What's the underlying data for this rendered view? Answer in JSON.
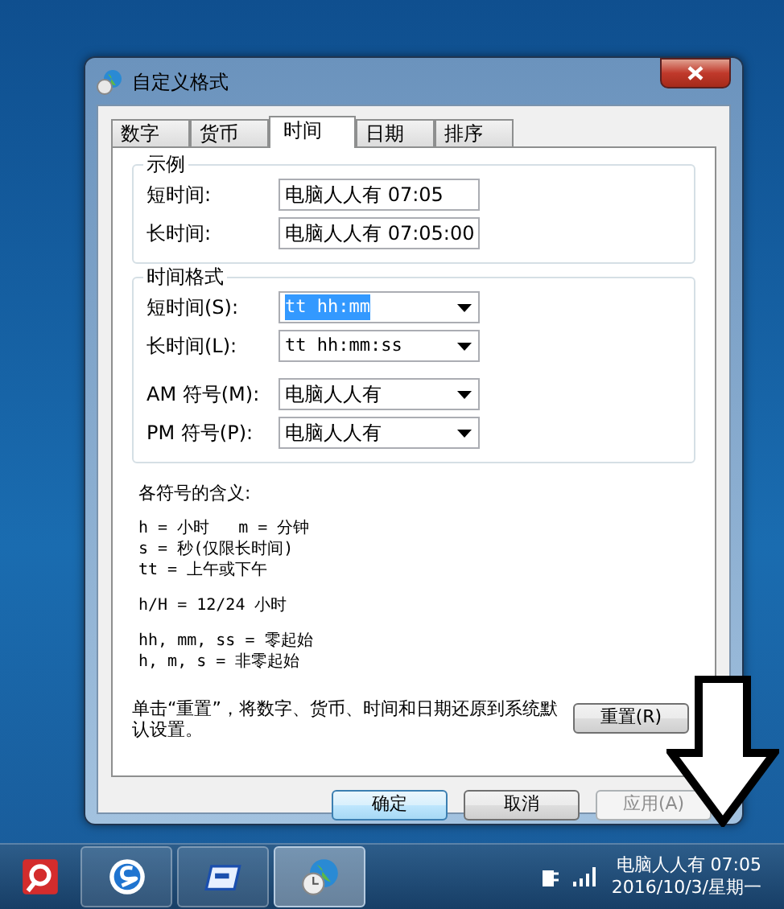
{
  "window": {
    "title": "自定义格式"
  },
  "tabs": [
    {
      "label": "数字",
      "selected": false
    },
    {
      "label": "货币",
      "selected": false
    },
    {
      "label": "时间",
      "selected": true
    },
    {
      "label": "日期",
      "selected": false
    },
    {
      "label": "排序",
      "selected": false
    }
  ],
  "example": {
    "title": "示例",
    "fields": [
      {
        "label": "短时间:",
        "value": "电脑人人有 07:05"
      },
      {
        "label": "长时间:",
        "value": "电脑人人有 07:05:00"
      }
    ]
  },
  "time_format": {
    "title": "时间格式",
    "fields": [
      {
        "label": "短时间(S):",
        "value": "tt hh:mm",
        "text_selected": true
      },
      {
        "label": "长时间(L):",
        "value": "tt hh:mm:ss",
        "text_selected": false
      },
      {
        "label": "AM 符号(M):",
        "value": "电脑人人有",
        "text_selected": false
      },
      {
        "label": "PM 符号(P):",
        "value": "电脑人人有",
        "text_selected": false
      }
    ]
  },
  "legend": {
    "title": "各符号的含义:",
    "groups": [
      [
        "h = 小时   m = 分钟",
        "s = 秒(仅限长时间)",
        "tt = 上午或下午"
      ],
      [
        "h/H = 12/24 小时"
      ],
      [
        "hh, mm, ss = 零起始",
        "h, m, s = 非零起始"
      ]
    ]
  },
  "reset": {
    "note": "单击“重置”，将数字、货币、时间和日期还原到系统默认设置。",
    "button": "重置(R)"
  },
  "buttons": [
    {
      "label": "确定",
      "default": true,
      "disabled": false
    },
    {
      "label": "取消",
      "default": false,
      "disabled": false
    },
    {
      "label": "应用(A)",
      "default": false,
      "disabled": true
    }
  ],
  "taskbar": {
    "buttons": [
      {
        "selected": false
      },
      {
        "selected": false
      },
      {
        "selected": false
      },
      {
        "selected": true
      }
    ],
    "clock": {
      "time": "电脑人人有 07:05",
      "date": "2016/10/3/星期一"
    }
  }
}
